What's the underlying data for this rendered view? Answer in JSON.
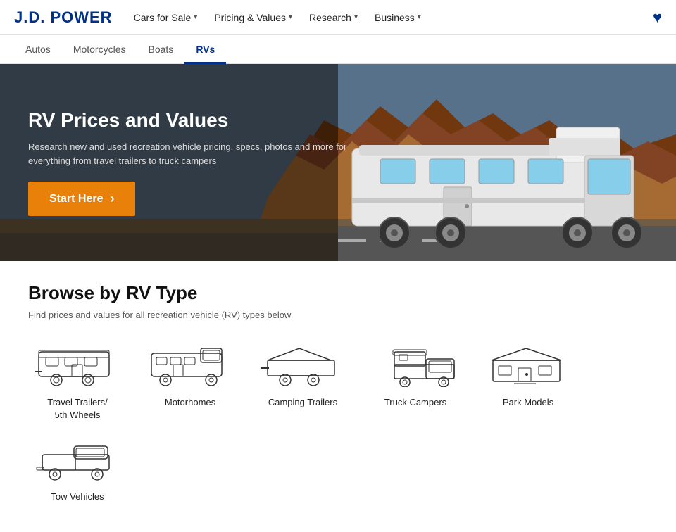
{
  "header": {
    "logo": "J.D. POWER",
    "nav": [
      {
        "label": "Cars for Sale",
        "hasChevron": true
      },
      {
        "label": "Pricing & Values",
        "hasChevron": true
      },
      {
        "label": "Research",
        "hasChevron": true
      },
      {
        "label": "Business",
        "hasChevron": true
      }
    ]
  },
  "subNav": {
    "items": [
      {
        "label": "Autos",
        "active": false
      },
      {
        "label": "Motorcycles",
        "active": false
      },
      {
        "label": "Boats",
        "active": false
      },
      {
        "label": "RVs",
        "active": true
      }
    ]
  },
  "hero": {
    "title": "RV Prices and Values",
    "subtitle": "Research new and used recreation vehicle pricing, specs, photos and more for everything from travel trailers to truck campers",
    "btnLabel": "Start Here"
  },
  "browse": {
    "title": "Browse by RV Type",
    "subtitle": "Find prices and values for all recreation vehicle (RV) types below",
    "rvTypes": [
      {
        "label": "Travel Trailers/\n5th Wheels",
        "type": "travel-trailer"
      },
      {
        "label": "Motorhomes",
        "type": "motorhome"
      },
      {
        "label": "Camping Trailers",
        "type": "camping-trailer"
      },
      {
        "label": "Truck Campers",
        "type": "truck-camper"
      },
      {
        "label": "Park Models",
        "type": "park-model"
      },
      {
        "label": "Tow Vehicles",
        "type": "tow-vehicle"
      }
    ]
  }
}
